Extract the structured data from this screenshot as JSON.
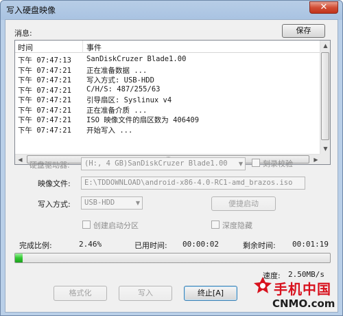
{
  "window": {
    "title": "写入硬盘映像",
    "close_glyph": "✕"
  },
  "messages": {
    "label": "消息:",
    "save_label": "保存",
    "columns": {
      "time": "时间",
      "event": "事件"
    },
    "rows": [
      {
        "time": "下午 07:47:13",
        "event": "SanDiskCruzer Blade1.00"
      },
      {
        "time": "下午 07:47:21",
        "event": "正在准备数据 ..."
      },
      {
        "time": "下午 07:47:21",
        "event": "写入方式: USB-HDD"
      },
      {
        "time": "下午 07:47:21",
        "event": "C/H/S: 487/255/63"
      },
      {
        "time": "下午 07:47:21",
        "event": "引导扇区: Syslinux v4"
      },
      {
        "time": "下午 07:47:21",
        "event": "正在准备介质 ..."
      },
      {
        "time": "下午 07:47:21",
        "event": "ISO 映像文件的扇区数为 406409"
      },
      {
        "time": "下午 07:47:21",
        "event": "开始写入 ..."
      }
    ]
  },
  "drive": {
    "label": "硬盘驱动器:",
    "value": "(H:, 4 GB)SanDiskCruzer Blade1.00",
    "verify_label": "刻录校验"
  },
  "image": {
    "label": "映像文件:",
    "value": "E:\\TDDOWNLOAD\\android-x86-4.0-RC1-amd_brazos.iso"
  },
  "write_mode": {
    "label": "写入方式:",
    "value": "USB-HDD",
    "quick_boot_label": "便捷启动"
  },
  "options": {
    "create_boot_partition": "创建启动分区",
    "hidden": "深度隐藏"
  },
  "status": {
    "completion_label": "完成比例:",
    "completion_value": "2.46%",
    "elapsed_label": "已用时间:",
    "elapsed_value": "00:00:02",
    "remaining_label": "剩余时间:",
    "remaining_value": "00:01:19",
    "speed_label": "速度:",
    "speed_value": "2.50MB/s",
    "progress_percent": 2.46
  },
  "actions": {
    "format_label": "格式化",
    "write_label": "写入",
    "stop_label": "终止[A]"
  },
  "watermark": {
    "main": "手机中国",
    "sub": "CNMO.com"
  },
  "colors": {
    "progress": "#32c832",
    "watermark_red": "#d8121e"
  }
}
